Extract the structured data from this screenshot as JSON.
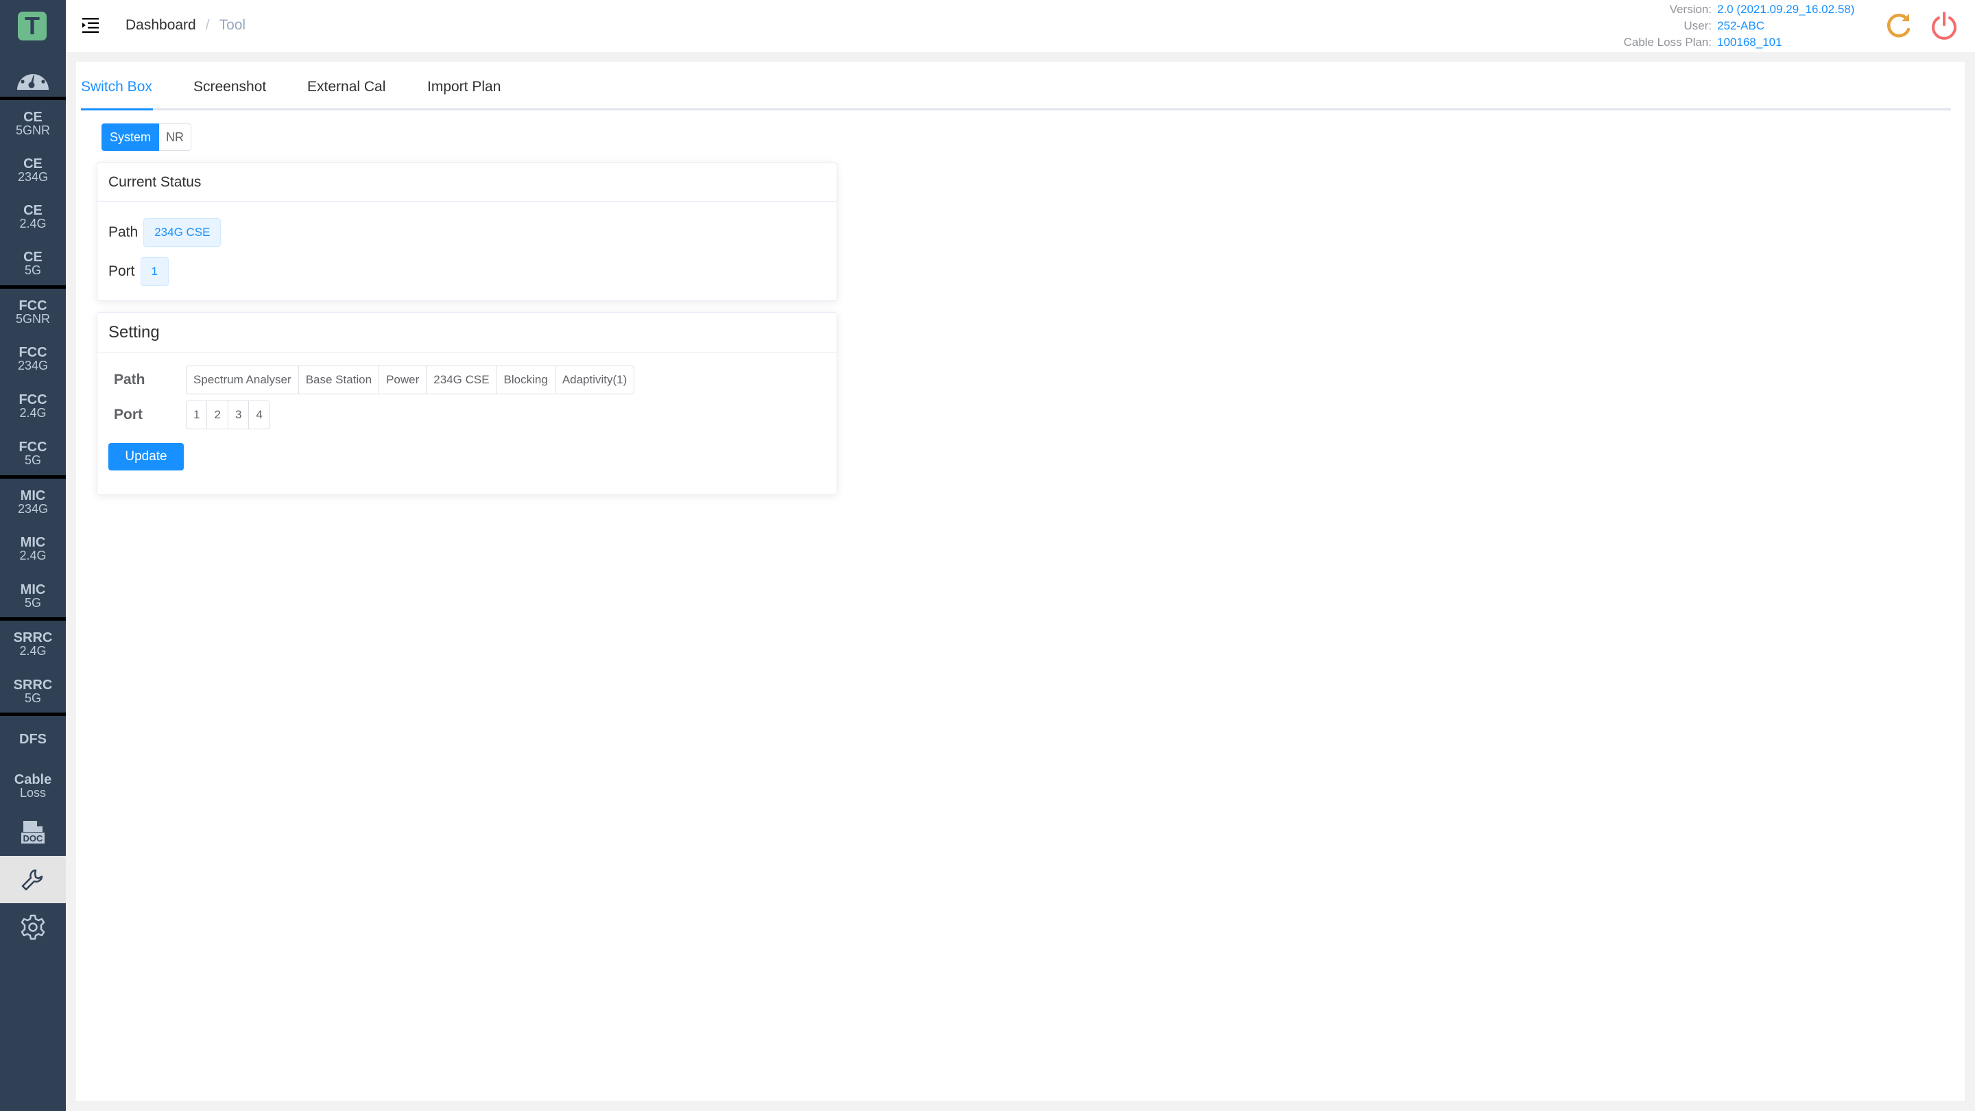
{
  "logo": {
    "letter": "T"
  },
  "sidebar": {
    "items": [
      {
        "l1": "CE",
        "l2": "5GNR"
      },
      {
        "l1": "CE",
        "l2": "234G"
      },
      {
        "l1": "CE",
        "l2": "2.4G"
      },
      {
        "l1": "CE",
        "l2": "5G"
      },
      {
        "l1": "FCC",
        "l2": "5GNR"
      },
      {
        "l1": "FCC",
        "l2": "234G"
      },
      {
        "l1": "FCC",
        "l2": "2.4G"
      },
      {
        "l1": "FCC",
        "l2": "5G"
      },
      {
        "l1": "MIC",
        "l2": "234G"
      },
      {
        "l1": "MIC",
        "l2": "2.4G"
      },
      {
        "l1": "MIC",
        "l2": "5G"
      },
      {
        "l1": "SRRC",
        "l2": "2.4G"
      },
      {
        "l1": "SRRC",
        "l2": "5G"
      },
      {
        "l1": "DFS",
        "l2": ""
      },
      {
        "l1": "Cable",
        "l2": "Loss"
      }
    ],
    "doc_label": "DOC",
    "tooltip": "Tool"
  },
  "header": {
    "breadcrumb": [
      "Dashboard",
      "Tool"
    ],
    "breadcrumb_sep": "/",
    "info": [
      {
        "label": "Version:",
        "value": "2.0 (2021.09.29_16.02.58)"
      },
      {
        "label": "User:",
        "value": "252-ABC"
      },
      {
        "label": "Cable Loss Plan:",
        "value": "100168_101"
      }
    ],
    "refresh_color": "#e6a23c",
    "power_color": "#f56c6c"
  },
  "tabs": [
    "Switch Box",
    "Screenshot",
    "External Cal",
    "Import Plan"
  ],
  "segment": {
    "options": [
      "System",
      "NR"
    ],
    "selected": "System"
  },
  "current_status": {
    "title": "Current Status",
    "path_label": "Path",
    "path_value": "234G CSE",
    "port_label": "Port",
    "port_value": "1"
  },
  "setting": {
    "title": "Setting",
    "path_label": "Path",
    "paths": [
      "Spectrum Analyser",
      "Base Station",
      "Power",
      "234G CSE",
      "Blocking",
      "Adaptivity(1)"
    ],
    "port_label": "Port",
    "ports": [
      "1",
      "2",
      "3",
      "4"
    ],
    "update_label": "Update"
  },
  "accent": "#1890ff"
}
